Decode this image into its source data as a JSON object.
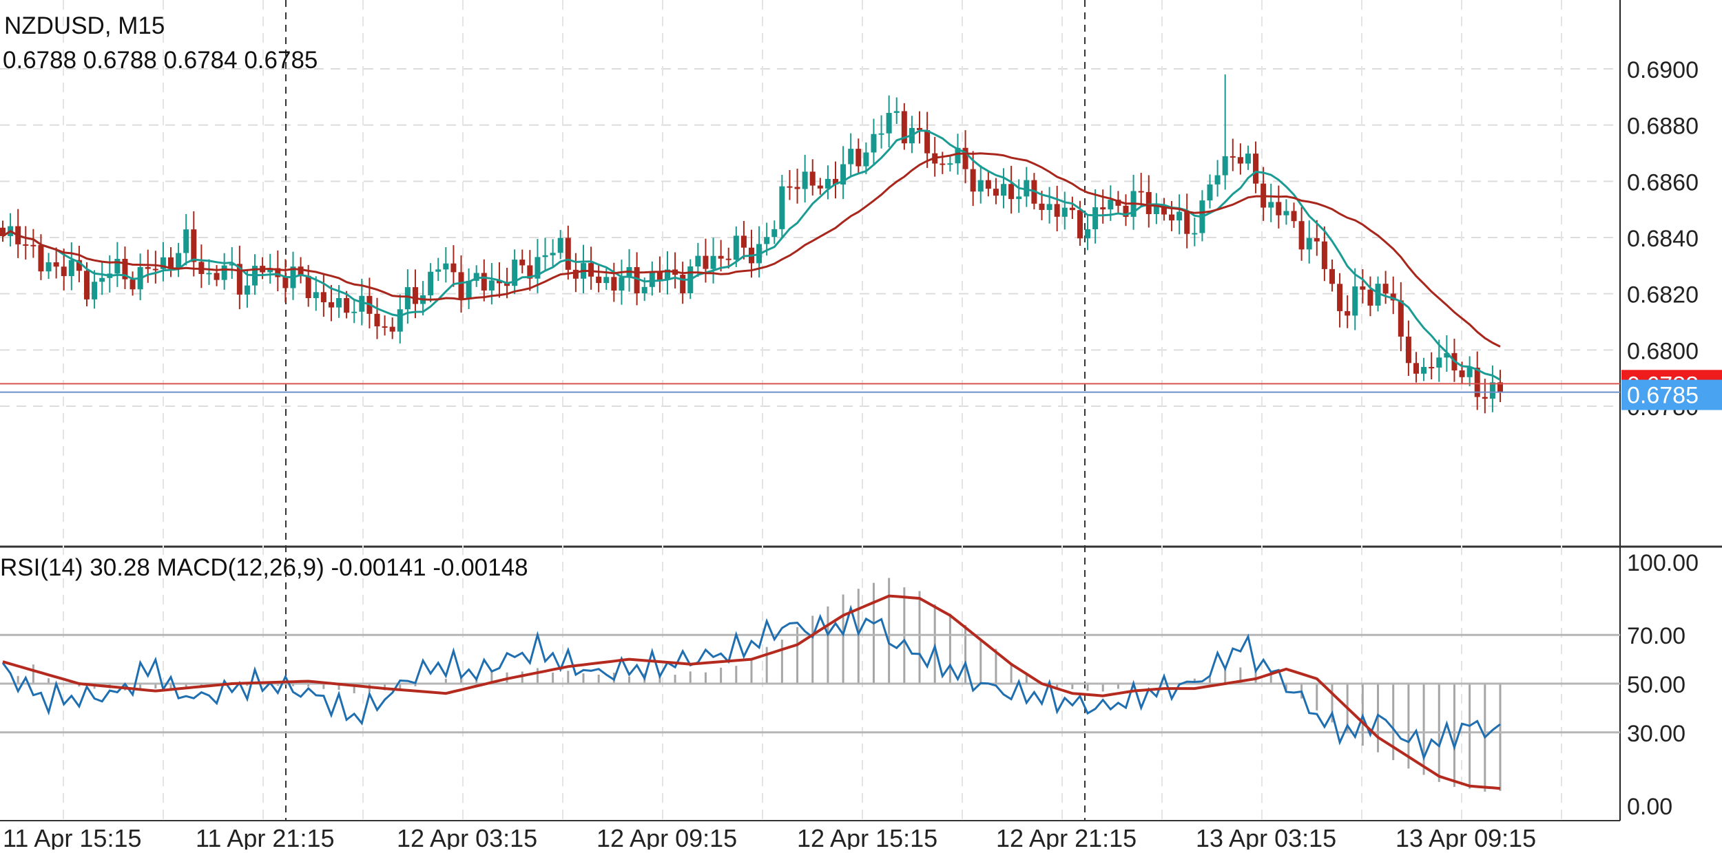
{
  "header": {
    "symbol_label": "NZDUSD, M15",
    "ohlc_label": "0.6788 0.6788 0.6784 0.6785",
    "indicator_label": "RSI(14) 30.28 MACD(12,26,9) -0.00141 -0.00148"
  },
  "colors": {
    "bull": "#17988f",
    "bear": "#a8261b",
    "fast_ma": "#1a9b93",
    "slow_ma": "#a8261b",
    "rsi": "#1f6fb0",
    "signal": "#b52a1e",
    "histogram": "#a6a6a6",
    "ask_line": "#d9534f",
    "bid_line": "#6f8fc9",
    "ask_badge": "#ee1c1c",
    "bid_badge": "#4aa3f0"
  },
  "chart_data": [
    {
      "type": "candlestick",
      "title": "NZDUSD, M15",
      "ylim": [
        0.6765,
        0.6915
      ],
      "y_ticks": [
        "0.6900",
        "0.6880",
        "0.6860",
        "0.6840",
        "0.6820",
        "0.6800",
        "0.6780"
      ],
      "x_ticks": [
        "11 Apr 15:15",
        "11 Apr 21:15",
        "12 Apr 03:15",
        "12 Apr 09:15",
        "12 Apr 15:15",
        "12 Apr 21:15",
        "13 Apr 03:15",
        "13 Apr 09:15"
      ],
      "last_price_ask": 0.6788,
      "last_price_bid": 0.6785,
      "ask_badge_text": "0.6788",
      "bid_badge_text": "0.6785",
      "moving_averages": 2,
      "grid": true,
      "price_anchors": [
        [
          0,
          0.6838
        ],
        [
          2,
          0.6843
        ],
        [
          5,
          0.6829
        ],
        [
          8,
          0.6831
        ],
        [
          11,
          0.6822
        ],
        [
          14,
          0.6828
        ],
        [
          18,
          0.6826
        ],
        [
          22,
          0.6833
        ],
        [
          24,
          0.6837
        ],
        [
          27,
          0.6826
        ],
        [
          30,
          0.6828
        ],
        [
          32,
          0.6823
        ],
        [
          34,
          0.6829
        ],
        [
          37,
          0.6826
        ],
        [
          40,
          0.6823
        ],
        [
          42,
          0.6817
        ],
        [
          44,
          0.6814
        ],
        [
          46,
          0.6818
        ],
        [
          48,
          0.6812
        ],
        [
          50,
          0.6807
        ],
        [
          52,
          0.6814
        ],
        [
          55,
          0.6822
        ],
        [
          57,
          0.683
        ],
        [
          60,
          0.6824
        ],
        [
          63,
          0.6823
        ],
        [
          67,
          0.6827
        ],
        [
          70,
          0.6832
        ],
        [
          73,
          0.6836
        ],
        [
          74,
          0.6832
        ],
        [
          76,
          0.6826
        ],
        [
          79,
          0.6825
        ],
        [
          83,
          0.6824
        ],
        [
          86,
          0.6826
        ],
        [
          89,
          0.6826
        ],
        [
          93,
          0.6833
        ],
        [
          97,
          0.6836
        ],
        [
          99,
          0.6836
        ],
        [
          101,
          0.6843
        ],
        [
          102,
          0.6855
        ],
        [
          103,
          0.6862
        ],
        [
          105,
          0.6858
        ],
        [
          108,
          0.686
        ],
        [
          110,
          0.6864
        ],
        [
          112,
          0.687
        ],
        [
          114,
          0.6874
        ],
        [
          116,
          0.6882
        ],
        [
          117,
          0.6885
        ],
        [
          118,
          0.6879
        ],
        [
          119,
          0.6876
        ],
        [
          121,
          0.6873
        ],
        [
          122,
          0.6866
        ],
        [
          124,
          0.6868
        ],
        [
          126,
          0.6865
        ],
        [
          128,
          0.6858
        ],
        [
          130,
          0.6855
        ],
        [
          132,
          0.6858
        ],
        [
          135,
          0.6853
        ],
        [
          138,
          0.685
        ],
        [
          140,
          0.6846
        ],
        [
          142,
          0.6844
        ],
        [
          144,
          0.6851
        ],
        [
          146,
          0.6852
        ],
        [
          149,
          0.6853
        ],
        [
          151,
          0.6851
        ],
        [
          153,
          0.6847
        ],
        [
          154,
          0.6844
        ],
        [
          155,
          0.6843
        ],
        [
          157,
          0.685
        ],
        [
          158,
          0.6858
        ],
        [
          160,
          0.6867
        ],
        [
          161,
          0.6873
        ],
        [
          162,
          0.6867
        ],
        [
          164,
          0.6861
        ],
        [
          165,
          0.6853
        ],
        [
          167,
          0.685
        ],
        [
          169,
          0.6843
        ],
        [
          171,
          0.684
        ],
        [
          173,
          0.683
        ],
        [
          174,
          0.6822
        ],
        [
          175,
          0.6815
        ],
        [
          177,
          0.6818
        ],
        [
          179,
          0.682
        ],
        [
          180,
          0.6823
        ],
        [
          182,
          0.6818
        ],
        [
          183,
          0.68
        ],
        [
          185,
          0.6796
        ],
        [
          186,
          0.679
        ],
        [
          187,
          0.6793
        ],
        [
          188,
          0.6798
        ],
        [
          190,
          0.6797
        ],
        [
          191,
          0.679
        ],
        [
          193,
          0.6786
        ],
        [
          194,
          0.6785
        ],
        [
          195,
          0.6787
        ],
        [
          196,
          0.6785
        ]
      ]
    },
    {
      "type": "line",
      "title": "RSI(14) 30.28 MACD(12,26,9) -0.00141 -0.00148",
      "ylim": [
        0,
        100
      ],
      "y_ticks": [
        "100.00",
        "70.00",
        "50.00",
        "30.00",
        "0.00"
      ],
      "rsi_value": 30.28,
      "macd_value": -0.00141,
      "signal_value": -0.00148,
      "series": [
        {
          "values": [
            [
              0,
              56
            ],
            [
              5,
              44
            ],
            [
              10,
              44
            ],
            [
              15,
              46
            ],
            [
              20,
              58
            ],
            [
              22,
              47
            ],
            [
              26,
              44
            ],
            [
              30,
              48
            ],
            [
              34,
              50
            ],
            [
              38,
              48
            ],
            [
              42,
              44
            ],
            [
              46,
              36
            ],
            [
              50,
              44
            ],
            [
              54,
              54
            ],
            [
              58,
              58
            ],
            [
              62,
              54
            ],
            [
              66,
              60
            ],
            [
              70,
              64
            ],
            [
              74,
              58
            ],
            [
              78,
              54
            ],
            [
              82,
              56
            ],
            [
              86,
              57
            ],
            [
              90,
              60
            ],
            [
              94,
              62
            ],
            [
              98,
              66
            ],
            [
              101,
              72
            ],
            [
              103,
              74
            ],
            [
              106,
              72
            ],
            [
              110,
              74
            ],
            [
              114,
              76
            ],
            [
              117,
              66
            ],
            [
              120,
              62
            ],
            [
              124,
              56
            ],
            [
              128,
              50
            ],
            [
              132,
              46
            ],
            [
              136,
              45
            ],
            [
              140,
              42
            ],
            [
              144,
              40
            ],
            [
              148,
              44
            ],
            [
              152,
              48
            ],
            [
              156,
              50
            ],
            [
              160,
              60
            ],
            [
              162,
              66
            ],
            [
              165,
              58
            ],
            [
              168,
              50
            ],
            [
              171,
              40
            ],
            [
              174,
              32
            ],
            [
              177,
              30
            ],
            [
              180,
              36
            ],
            [
              183,
              29
            ],
            [
              186,
              24
            ],
            [
              189,
              28
            ],
            [
              192,
              33
            ],
            [
              196,
              30
            ]
          ]
        },
        {
          "values": [
            [
              0,
              59
            ],
            [
              10,
              50
            ],
            [
              20,
              47
            ],
            [
              30,
              50
            ],
            [
              40,
              51
            ],
            [
              50,
              48
            ],
            [
              58,
              46
            ],
            [
              66,
              52
            ],
            [
              74,
              57
            ],
            [
              82,
              60
            ],
            [
              90,
              58
            ],
            [
              98,
              60
            ],
            [
              104,
              66
            ],
            [
              110,
              78
            ],
            [
              116,
              86
            ],
            [
              120,
              85
            ],
            [
              124,
              78
            ],
            [
              128,
              68
            ],
            [
              132,
              58
            ],
            [
              136,
              50
            ],
            [
              140,
              46
            ],
            [
              144,
              45
            ],
            [
              148,
              47
            ],
            [
              152,
              48
            ],
            [
              156,
              48
            ],
            [
              160,
              50
            ],
            [
              164,
              52
            ],
            [
              168,
              56
            ],
            [
              172,
              52
            ],
            [
              176,
              40
            ],
            [
              180,
              28
            ],
            [
              184,
              20
            ],
            [
              188,
              12
            ],
            [
              192,
              8
            ],
            [
              196,
              7
            ]
          ]
        }
      ],
      "histogram_anchors": [
        [
          0,
          0.0
        ],
        [
          4,
          0.0001
        ],
        [
          8,
          -2e-05
        ],
        [
          12,
          -6e-05
        ],
        [
          16,
          -8e-05
        ],
        [
          22,
          -6e-05
        ],
        [
          30,
          -2e-05
        ],
        [
          36,
          -2e-05
        ],
        [
          42,
          -6e-05
        ],
        [
          46,
          -0.00012
        ],
        [
          52,
          -8e-05
        ],
        [
          58,
          3e-05
        ],
        [
          64,
          6e-05
        ],
        [
          70,
          8e-05
        ],
        [
          76,
          6e-05
        ],
        [
          82,
          5e-05
        ],
        [
          90,
          6e-05
        ],
        [
          96,
          0.0001
        ],
        [
          100,
          0.0002
        ],
        [
          104,
          0.00032
        ],
        [
          108,
          0.00045
        ],
        [
          112,
          0.00055
        ],
        [
          116,
          0.0006
        ],
        [
          120,
          0.00052
        ],
        [
          124,
          0.0004
        ],
        [
          128,
          0.00026
        ],
        [
          132,
          0.00012
        ],
        [
          136,
          0.0
        ],
        [
          140,
          -8e-05
        ],
        [
          144,
          -0.0001
        ],
        [
          148,
          -5e-05
        ],
        [
          152,
          0.0
        ],
        [
          156,
          2e-05
        ],
        [
          160,
          8e-05
        ],
        [
          163,
          0.0001
        ],
        [
          166,
          5e-05
        ],
        [
          170,
          -0.0002
        ],
        [
          174,
          -0.0005
        ],
        [
          178,
          -0.0008
        ],
        [
          182,
          -0.001
        ],
        [
          186,
          -0.0012
        ],
        [
          190,
          -0.00135
        ],
        [
          194,
          -0.0014
        ],
        [
          196,
          -0.00141
        ]
      ],
      "histogram_range": [
        -0.0015,
        0.00065
      ]
    }
  ]
}
